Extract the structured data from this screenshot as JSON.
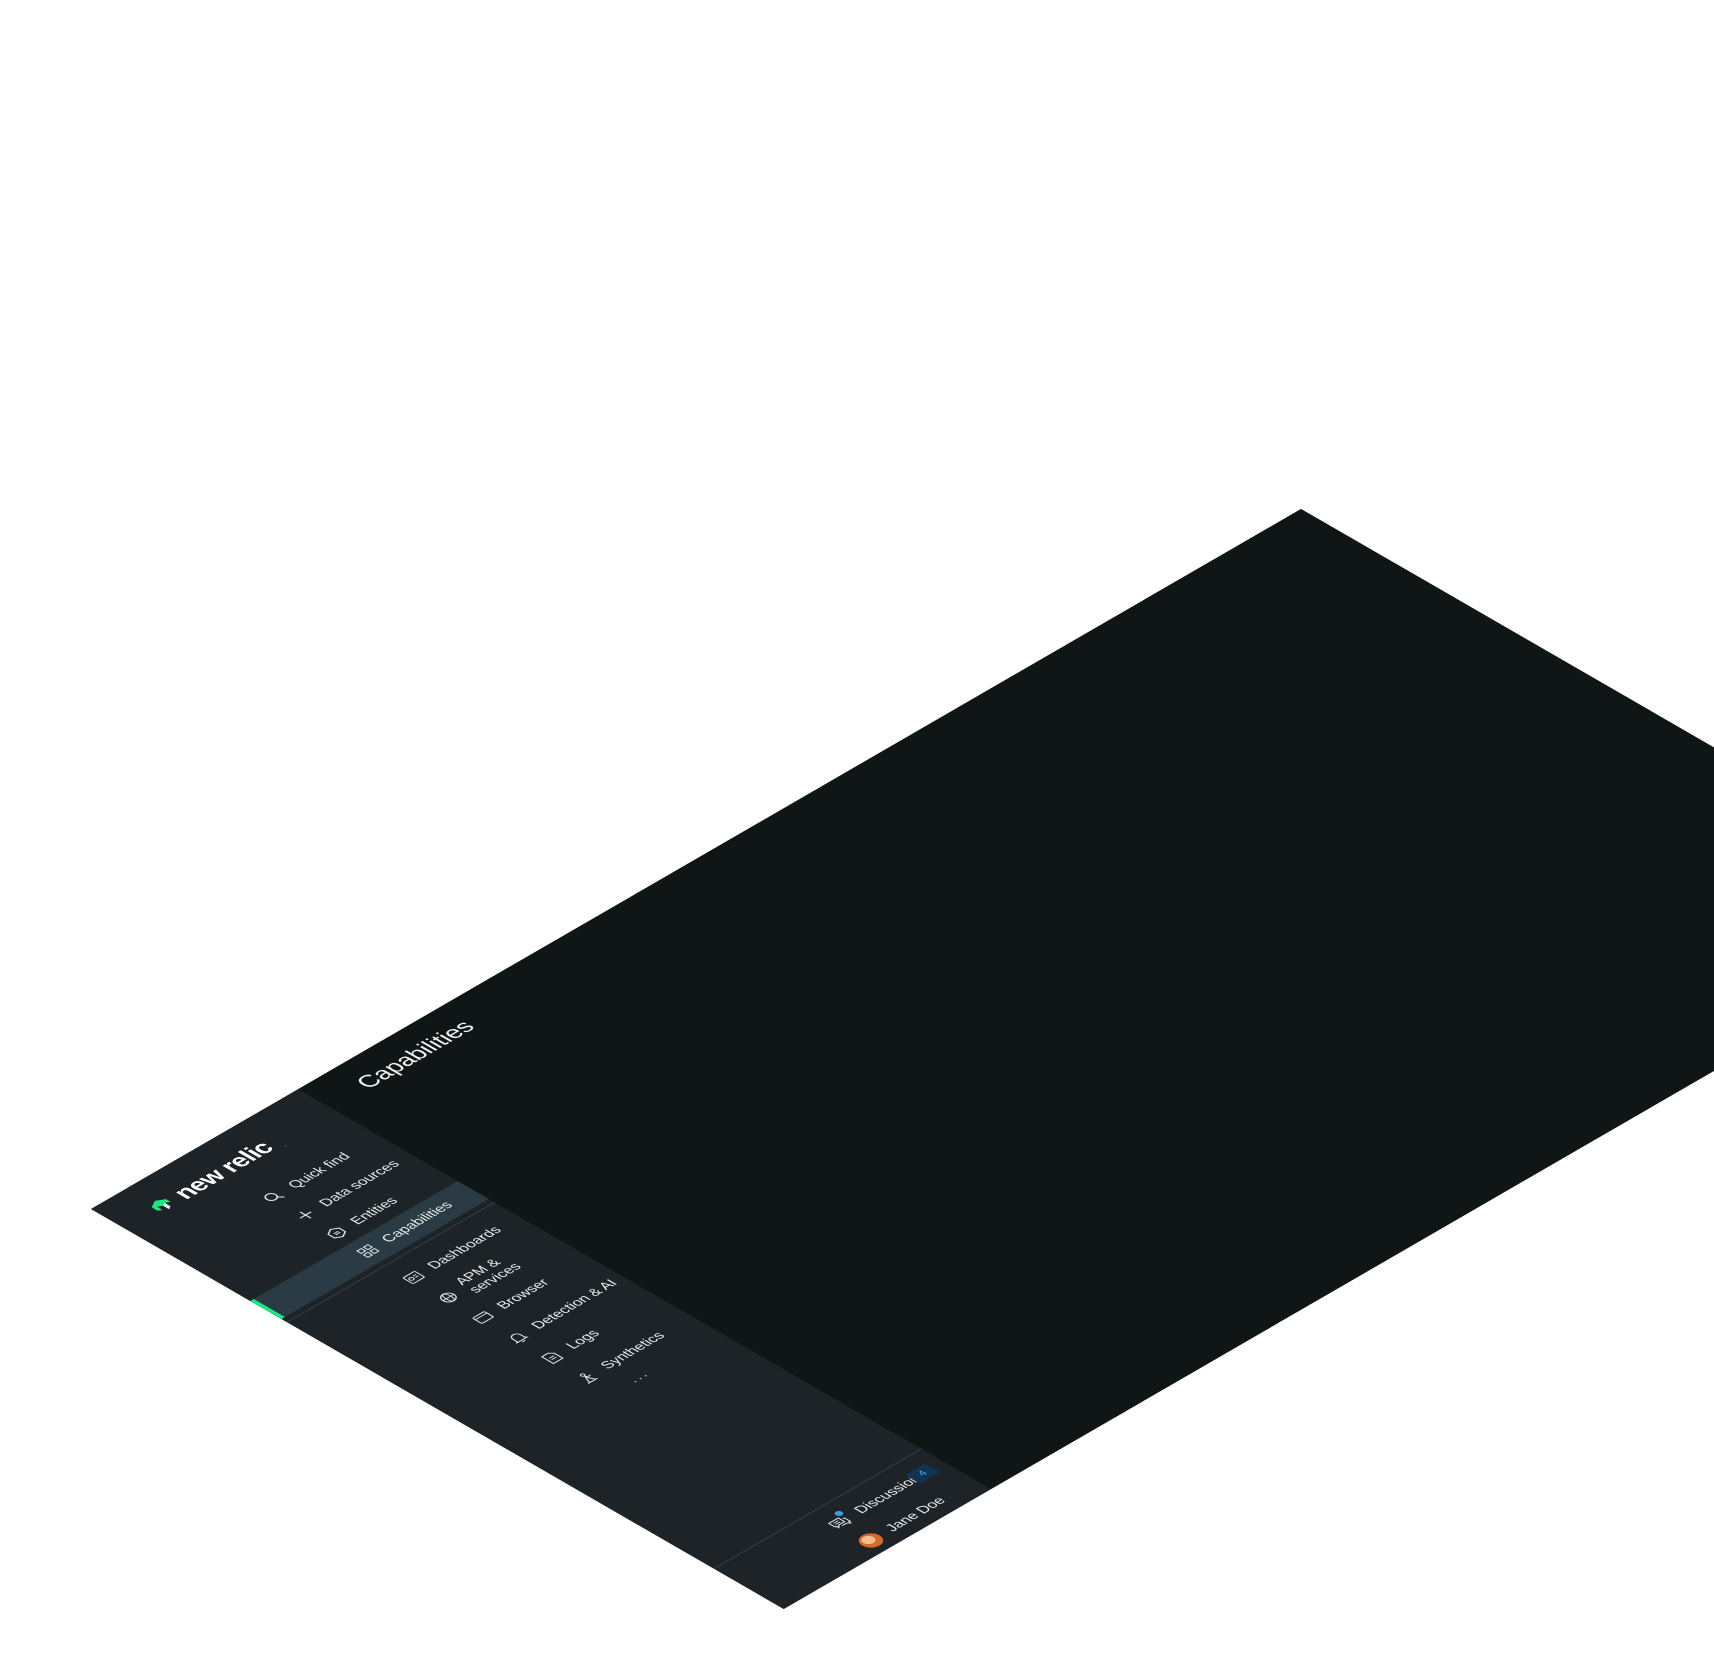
{
  "brand": {
    "name": "new relic",
    "trademark": ".",
    "accent_color": "#1ce783",
    "sidebar_bg": "#1d2327",
    "main_bg": "#101615"
  },
  "sidebar": {
    "primary": [
      {
        "label": "Quick find",
        "icon": "search-icon"
      },
      {
        "label": "Data sources",
        "icon": "plus-icon"
      },
      {
        "label": "Entities",
        "icon": "entities-icon"
      },
      {
        "label": "Capabilities",
        "icon": "grid-icon",
        "active": true
      }
    ],
    "capabilities": [
      {
        "label": "Dashboards",
        "icon": "dashboard-icon"
      },
      {
        "label": "APM & services",
        "icon": "globe-icon"
      },
      {
        "label": "Browser",
        "icon": "browser-icon"
      },
      {
        "label": "Detection & AI",
        "icon": "bell-icon"
      },
      {
        "label": "Logs",
        "icon": "logs-icon"
      },
      {
        "label": "Synthetics",
        "icon": "synthetics-icon"
      }
    ],
    "more": "...",
    "bottom": {
      "discussions": {
        "label": "Discussions",
        "icon": "discussions-icon",
        "count": "4"
      },
      "user": {
        "label": "Jane Doe",
        "icon": "avatar"
      }
    }
  },
  "main": {
    "title": "Capabilities"
  }
}
